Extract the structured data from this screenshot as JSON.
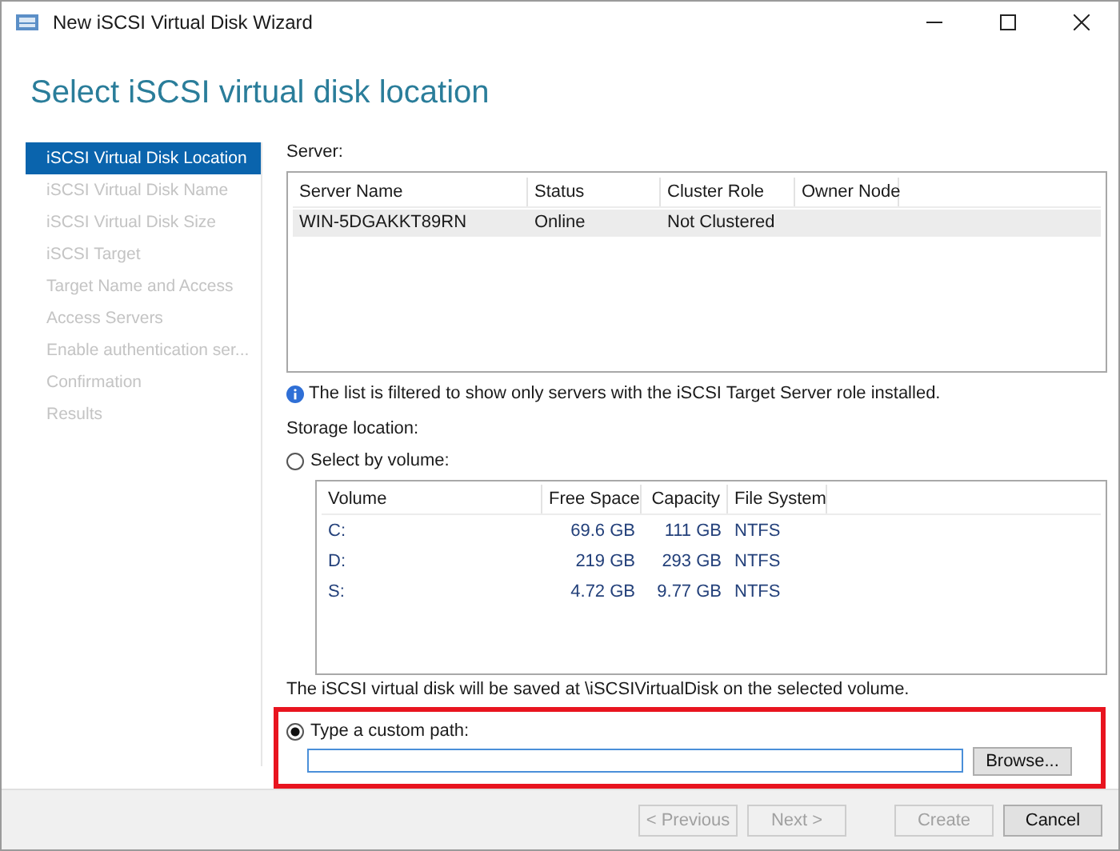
{
  "window": {
    "title": "New iSCSI Virtual Disk Wizard"
  },
  "heading": "Select iSCSI virtual disk location",
  "sidebar": {
    "items": [
      {
        "label": "iSCSI Virtual Disk Location",
        "selected": true,
        "disabled": false
      },
      {
        "label": "iSCSI Virtual Disk Name",
        "selected": false,
        "disabled": true
      },
      {
        "label": "iSCSI Virtual Disk Size",
        "selected": false,
        "disabled": true
      },
      {
        "label": "iSCSI Target",
        "selected": false,
        "disabled": true
      },
      {
        "label": "Target Name and Access",
        "selected": false,
        "disabled": true
      },
      {
        "label": "Access Servers",
        "selected": false,
        "disabled": true
      },
      {
        "label": "Enable authentication ser...",
        "selected": false,
        "disabled": true
      },
      {
        "label": "Confirmation",
        "selected": false,
        "disabled": true
      },
      {
        "label": "Results",
        "selected": false,
        "disabled": true
      }
    ]
  },
  "server": {
    "label": "Server:",
    "table": {
      "columns": [
        "Server Name",
        "Status",
        "Cluster Role",
        "Owner Node"
      ],
      "rows": [
        {
          "cells": [
            "WIN-5DGAKKT89RN",
            "Online",
            "Not Clustered",
            ""
          ],
          "selected": true
        }
      ]
    },
    "info": "The list is filtered to show only servers with the iSCSI Target Server role installed."
  },
  "storage": {
    "label": "Storage location:",
    "by_volume": {
      "label": "Select by volume:",
      "selected": false
    },
    "volumes": {
      "columns": [
        "Volume",
        "Free Space",
        "Capacity",
        "File System"
      ],
      "rows": [
        [
          "C:",
          "69.6 GB",
          "111 GB",
          "NTFS"
        ],
        [
          "D:",
          "219 GB",
          "293 GB",
          "NTFS"
        ],
        [
          "S:",
          "4.72 GB",
          "9.77 GB",
          "NTFS"
        ]
      ]
    },
    "note": "The iSCSI virtual disk will be saved at \\iSCSIVirtualDisk on the selected volume.",
    "custom_path": {
      "label": "Type a custom path:",
      "selected": true
    },
    "browse": "Browse..."
  },
  "buttons": [
    {
      "label": "< Previous",
      "disabled": true
    },
    {
      "label": "Next >",
      "disabled": true
    },
    {
      "label": "Create",
      "disabled": true
    },
    {
      "label": "Cancel",
      "disabled": false
    }
  ]
}
